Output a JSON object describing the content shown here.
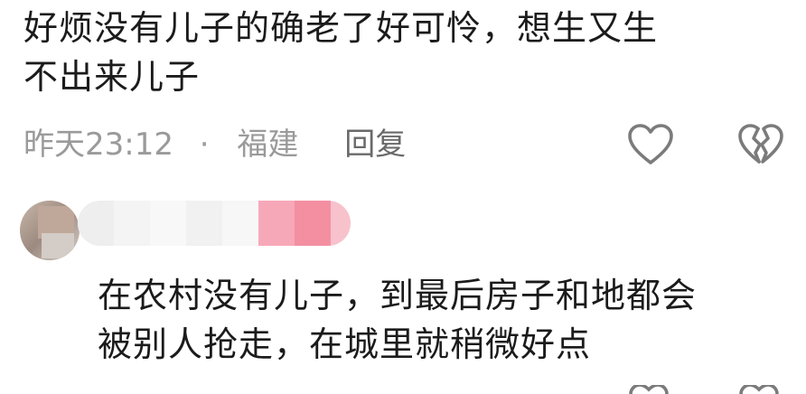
{
  "comments": [
    {
      "text_lines": [
        "好烦没有儿子的确老了好可怜，想生又生",
        "不出来儿子"
      ],
      "time": "昨天23:12",
      "separator": "·",
      "location": "福建",
      "reply_label": "回复"
    },
    {
      "text_lines": [
        "在农村没有儿子，到最后房子和地都会",
        "被别人抢走，在城里就稍微好点"
      ]
    }
  ],
  "icons": {
    "like": "heart-outline-icon",
    "dislike": "broken-heart-outline-icon"
  },
  "colors": {
    "text": "#1b1b1b",
    "meta": "#9a9a9a",
    "icon_stroke": "#7b7b7b",
    "username_mask_pink": "#f48fa2"
  }
}
